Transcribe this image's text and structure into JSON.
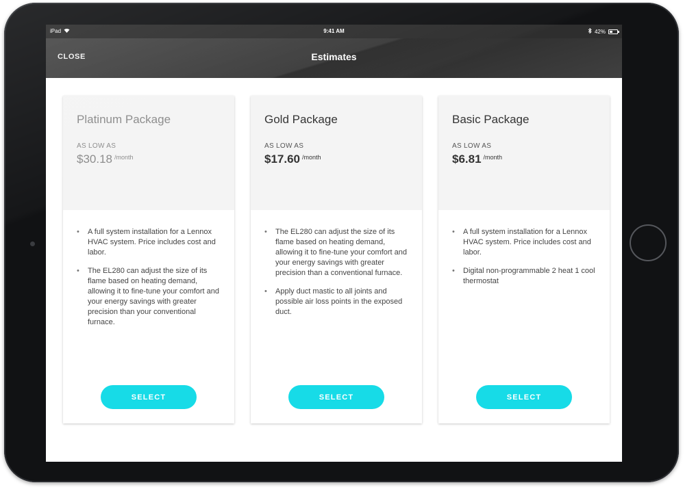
{
  "status_bar": {
    "device": "iPad",
    "time": "9:41 AM",
    "battery": "42%",
    "battery_level": 0.42
  },
  "nav": {
    "close_label": "CLOSE",
    "title": "Estimates"
  },
  "packages": [
    {
      "title": "Platinum Package",
      "price_label": "AS LOW AS",
      "price": "$30.18",
      "price_unit": "/month",
      "features": [
        "A full system installation for a Lennox HVAC system. Price includes cost and labor.",
        "The EL280 can adjust the size of its flame based on heating demand, allowing it to fine-tune your comfort and your energy savings with greater precision than your conventional furnace."
      ],
      "button": "SELECT"
    },
    {
      "title": "Gold Package",
      "price_label": "AS LOW AS",
      "price": "$17.60",
      "price_unit": "/month",
      "features": [
        "The EL280 can adjust the size of its flame based on heating demand, allowing it to fine-tune your comfort and your energy savings with greater precision than a conventional furnace.",
        "Apply duct mastic to all joints and possible air loss points in the exposed duct."
      ],
      "button": "SELECT"
    },
    {
      "title": "Basic Package",
      "price_label": "AS LOW AS",
      "price": "$6.81",
      "price_unit": "/month",
      "features": [
        "A full system installation for a Lennox HVAC system. Price includes cost and labor.",
        "Digital non-programmable 2 heat 1 cool thermostat"
      ],
      "button": "SELECT"
    }
  ],
  "colors": {
    "accent": "#17dbe7",
    "nav_bar": "#3a3a3a",
    "card_header": "#f4f4f4"
  }
}
